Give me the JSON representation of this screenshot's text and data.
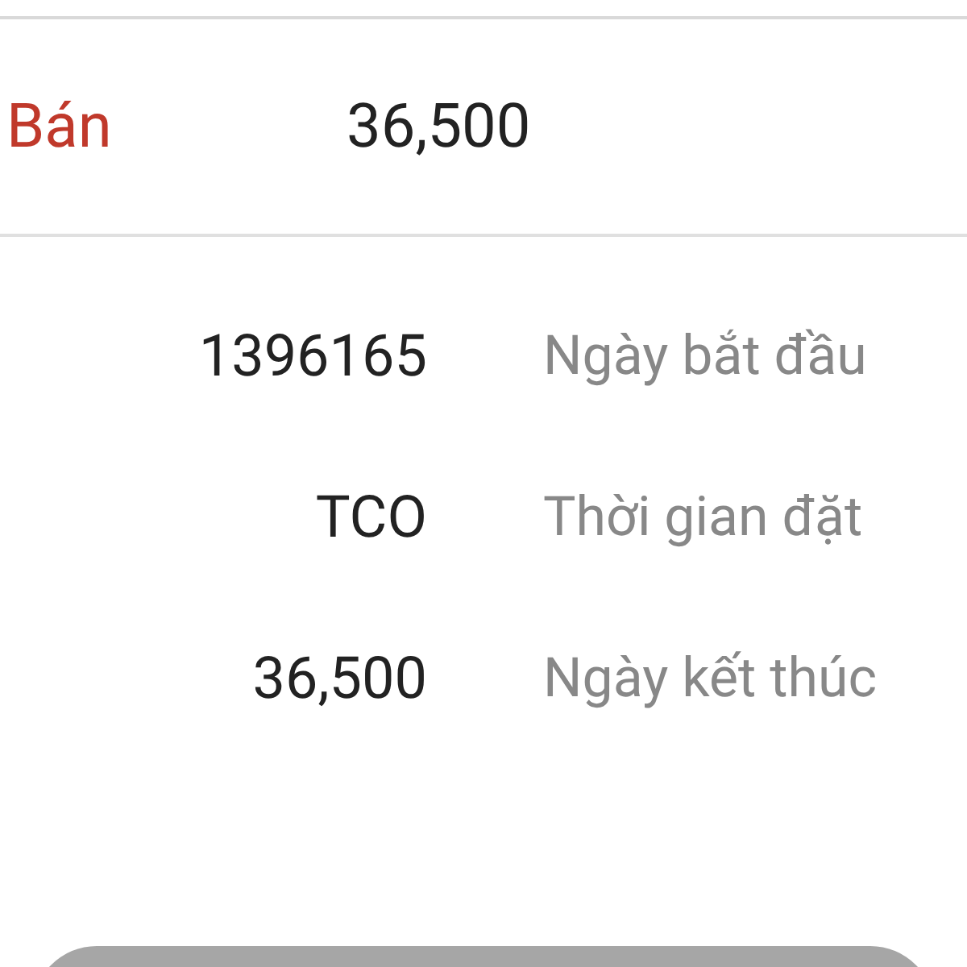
{
  "order_row": {
    "kind": "sell",
    "side_label": "Bán",
    "price": "36,500"
  },
  "details": [
    {
      "value": "1396165",
      "label": "Ngày bắt đầu"
    },
    {
      "value": "TCO",
      "label": "Thời gian đặt"
    },
    {
      "value": "36,500",
      "label": "Ngày kết thúc"
    }
  ],
  "bottom_button": {
    "disabled": true
  }
}
